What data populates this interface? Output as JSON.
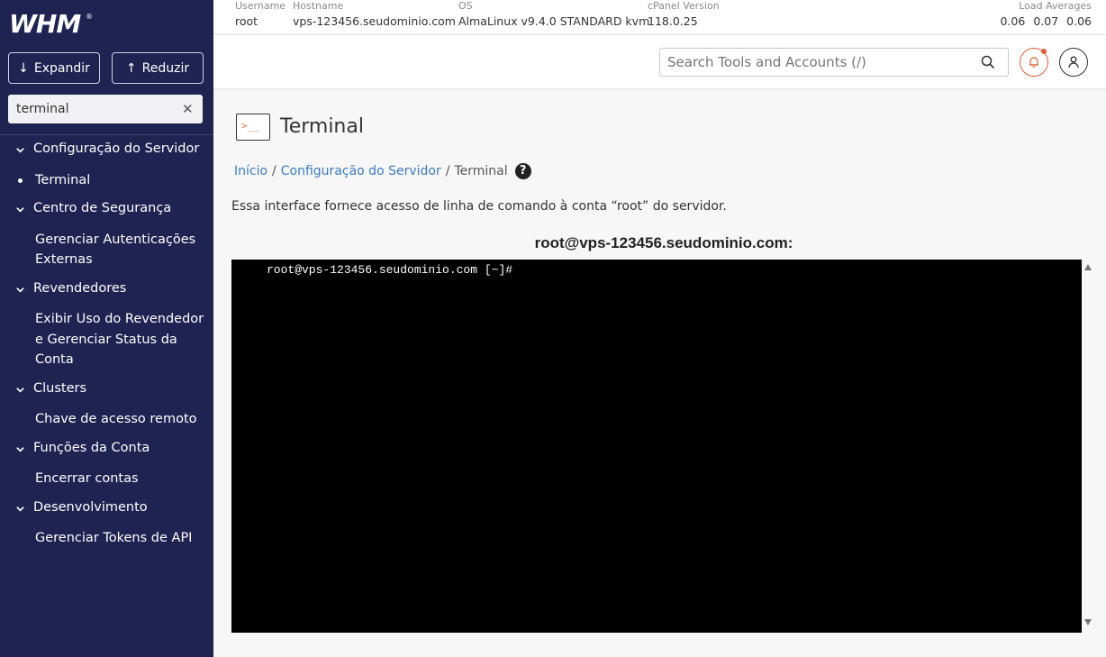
{
  "sidebar": {
    "logo": "WHM",
    "expand_label": "Expandir",
    "collapse_label": "Reduzir",
    "search_value": "terminal",
    "nav": [
      {
        "type": "category",
        "label": "Configuração do Servidor"
      },
      {
        "type": "item",
        "label": "Terminal",
        "active": true
      },
      {
        "type": "category",
        "label": "Centro de Segurança"
      },
      {
        "type": "item",
        "label": "Gerenciar Autenticações Externas"
      },
      {
        "type": "category",
        "label": "Revendedores"
      },
      {
        "type": "item",
        "label": "Exibir Uso do Revendedor e Gerenciar Status da Conta"
      },
      {
        "type": "category",
        "label": "Clusters"
      },
      {
        "type": "item",
        "label": "Chave de acesso remoto"
      },
      {
        "type": "category",
        "label": "Funções da Conta"
      },
      {
        "type": "item",
        "label": "Encerrar contas"
      },
      {
        "type": "category",
        "label": "Desenvolvimento"
      },
      {
        "type": "item",
        "label": "Gerenciar Tokens de API"
      }
    ]
  },
  "header": {
    "username_label": "Username",
    "username": "root",
    "hostname_label": "Hostname",
    "hostname": "vps-123456.seudominio.com",
    "os_label": "OS",
    "os": "AlmaLinux v9.4.0 STANDARD kvm",
    "cpanel_label": "cPanel Version",
    "cpanel_version": "118.0.25",
    "load_label": "Load Averages",
    "load_1": "0.06",
    "load_5": "0.07",
    "load_15": "0.06"
  },
  "toolbar": {
    "search_placeholder": "Search Tools and Accounts (/)"
  },
  "main": {
    "title": "Terminal",
    "breadcrumb": {
      "home": "Início",
      "section": "Configuração do Servidor",
      "current": "Terminal",
      "sep": "/"
    },
    "description": "Essa interface fornece acesso de linha de comando à conta “root” do servidor.",
    "terminal_title": "root@vps-123456.seudominio.com:",
    "terminal_prompt": "root@vps-123456.seudominio.com [~]#"
  },
  "colors": {
    "sidebar_bg": "#1f2352",
    "link": "#3b7bbf",
    "accent_orange": "#d9603b",
    "terminal_bg": "#000000"
  }
}
